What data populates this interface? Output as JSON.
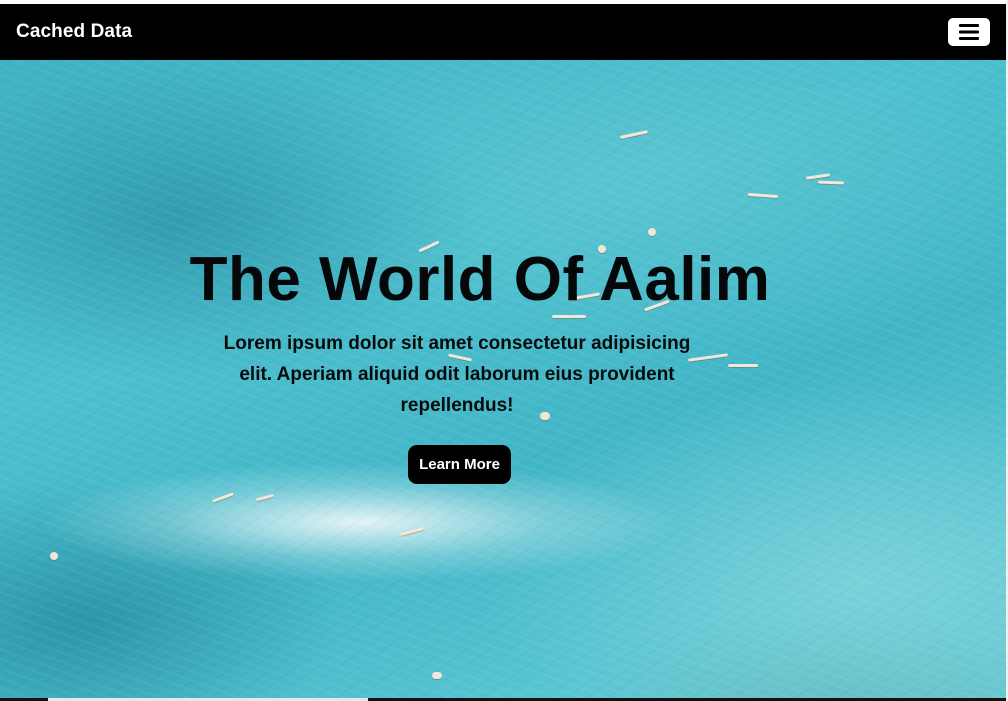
{
  "navbar": {
    "brand": "Cached Data",
    "menu_icon": "hamburger-menu-icon",
    "background_color": "#000000"
  },
  "hero": {
    "title": "The World Of Aalim",
    "text": "Lorem ipsum dolor sit amet consectetur adipisicing elit. Aperiam aliquid odit laborum eius provident repellendus!",
    "button_label": "Learn More",
    "background": "aerial-ocean-surfers-image",
    "accent_color": "#45b8c8"
  }
}
